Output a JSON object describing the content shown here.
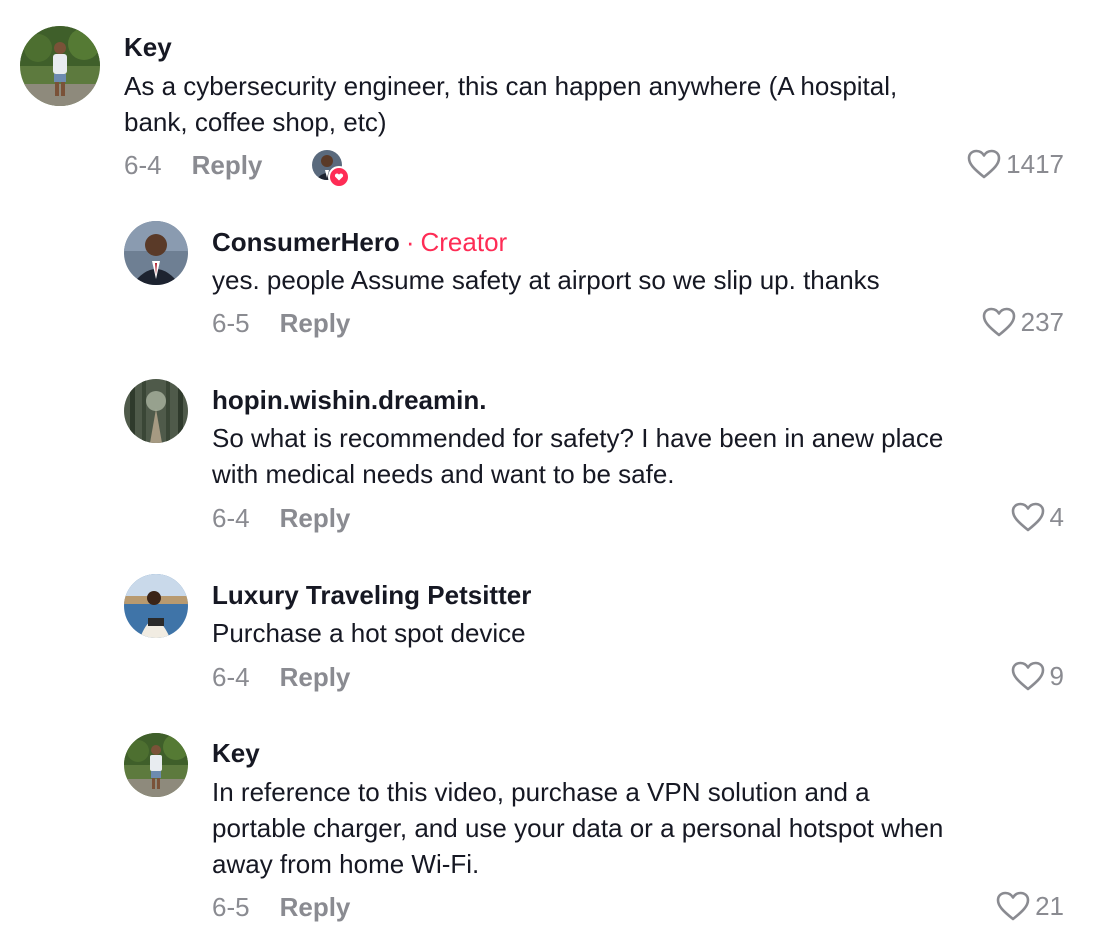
{
  "comments": [
    {
      "username": "Key",
      "text_lines": [
        "As a cybersecurity engineer, this can happen anywhere (A hospital,",
        "bank, coffee shop, etc)"
      ],
      "date": "6-4",
      "reply_label": "Reply",
      "likes": "1417",
      "liked_by_creator": true,
      "avatar_icon": "person-outdoors-avatar"
    },
    {
      "username": "ConsumerHero",
      "separator": "·",
      "creator_label": "Creator",
      "text_lines": [
        "yes. people Assume safety at airport so we slip up. thanks"
      ],
      "date": "6-5",
      "reply_label": "Reply",
      "likes": "237",
      "avatar_icon": "man-in-suit-avatar"
    },
    {
      "username": "hopin.wishin.dreamin.",
      "text_lines": [
        "So what is recommended for safety? I have been in anew place",
        "with medical needs and want to be safe."
      ],
      "date": "6-4",
      "reply_label": "Reply",
      "likes": "4",
      "avatar_icon": "forest-path-avatar"
    },
    {
      "username": "Luxury Traveling Petsitter",
      "text_lines": [
        "Purchase a hot spot device"
      ],
      "date": "6-4",
      "reply_label": "Reply",
      "likes": "9",
      "avatar_icon": "woman-by-water-avatar"
    },
    {
      "username": "Key",
      "text_lines": [
        "In reference to this video, purchase a VPN solution and a",
        "portable charger, and use your data or a personal hotspot when",
        "away from home Wi-Fi."
      ],
      "date": "6-5",
      "reply_label": "Reply",
      "likes": "21",
      "avatar_icon": "person-outdoors-avatar"
    }
  ],
  "colors": {
    "text": "#161823",
    "muted": "#8a8b91",
    "creator": "#fe2c55"
  }
}
